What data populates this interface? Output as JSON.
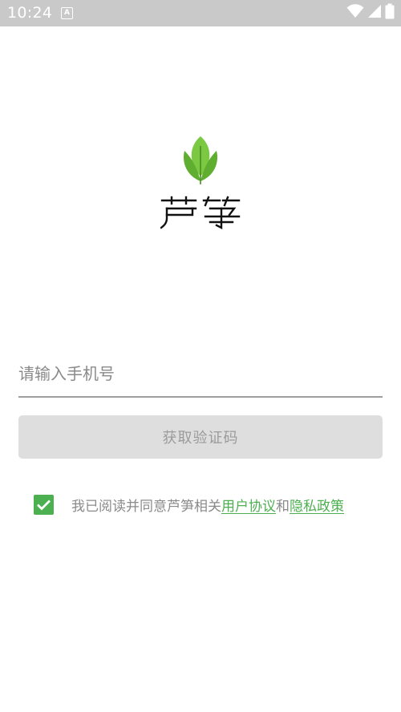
{
  "status_bar": {
    "time": "10:24",
    "notification_icon": "a-icon",
    "icons": [
      "wifi-icon",
      "signal-icon",
      "battery-icon"
    ]
  },
  "brand": {
    "logo_icon": "leaf-icon",
    "name": "芦笋",
    "accent_color": "#4caf50"
  },
  "login": {
    "phone_placeholder": "请输入手机号",
    "phone_value": "",
    "get_code_label": "获取验证码"
  },
  "agreement": {
    "checked": true,
    "prefix": "我已阅读并同意芦笋相关",
    "user_agreement": "用户协议",
    "conjunction": "和",
    "privacy_policy": "隐私政策"
  }
}
